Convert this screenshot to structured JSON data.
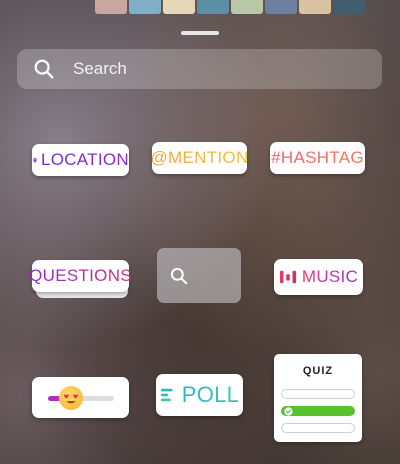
{
  "search": {
    "placeholder": "Search"
  },
  "stickers": {
    "location": {
      "label": "LOCATION"
    },
    "mention": {
      "label": "@MENTION"
    },
    "hashtag": {
      "label": "#HASHTAG"
    },
    "questions": {
      "label": "QUESTIONS"
    },
    "music": {
      "label": "MUSIC"
    },
    "poll": {
      "label": "POLL"
    },
    "quiz": {
      "title": "QUIZ"
    },
    "emoji_slider": {
      "emoji": "😍",
      "level": 0.35
    }
  },
  "icons": [
    "search-icon",
    "location-pin-icon",
    "music-bars-icon",
    "poll-lines-icon",
    "check-icon"
  ],
  "colors": {
    "location": "#7a2bd3",
    "mention": "#f2a53b",
    "hashtag": "#ec5f7a",
    "music": "#e33b6b",
    "poll": "#2fb3d0",
    "quiz_correct": "#57c22e"
  }
}
